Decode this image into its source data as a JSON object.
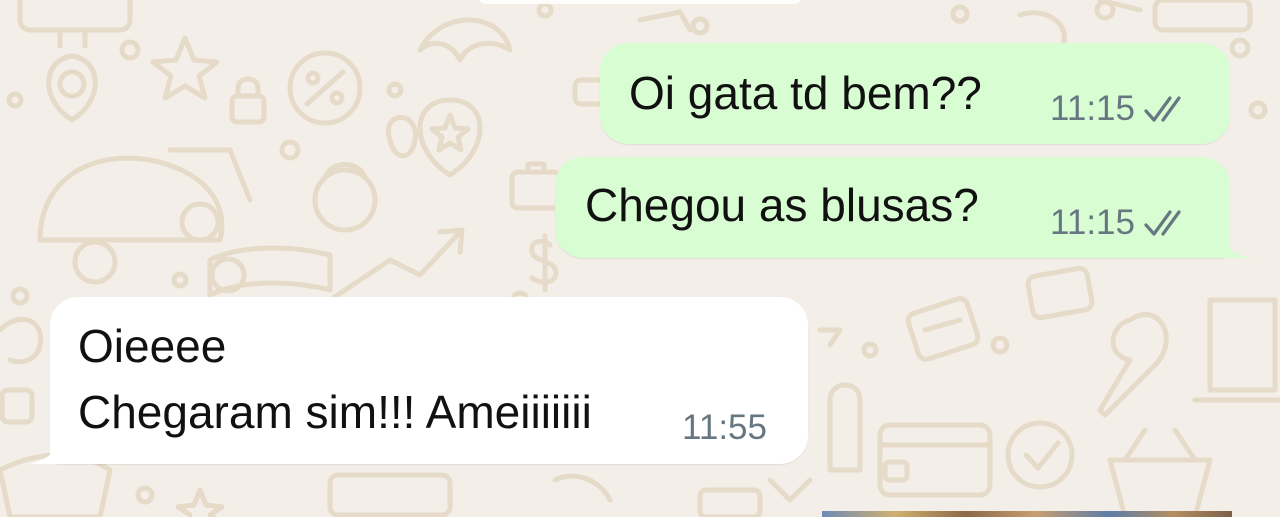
{
  "theme": {
    "background": "#f3efe8",
    "doodle_color": "#e6dac8",
    "outgoing_bubble": "#d9fdd3",
    "incoming_bubble": "#ffffff",
    "text_color": "#111111",
    "meta_color": "#667781"
  },
  "messages": [
    {
      "direction": "outgoing",
      "lines": [
        "Oi gata td bem??"
      ],
      "time": "11:15",
      "status_icon": "double-check-icon"
    },
    {
      "direction": "outgoing",
      "lines": [
        "Chegou as blusas?"
      ],
      "time": "11:15",
      "status_icon": "double-check-icon"
    },
    {
      "direction": "incoming",
      "lines": [
        "Oieeee",
        "Chegaram sim!!! Ameiiiiiii"
      ],
      "time": "11:55"
    }
  ]
}
